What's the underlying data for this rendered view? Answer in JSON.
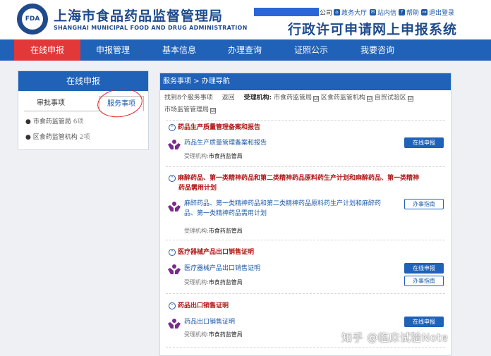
{
  "header": {
    "logo_text": "FDA",
    "org_name_cn": "上海市食品药品监督管理局",
    "org_name_en": "SHANGHAI MUNICIPAL FOOD AND DRUG ADMINISTRATION",
    "company_suffix": "公司",
    "links": [
      "政务大厅",
      "站内信",
      "帮助",
      "退出登录"
    ],
    "system_title": "行政许可申请网上申报系统"
  },
  "nav": {
    "items": [
      "在线申报",
      "申报管理",
      "基本信息",
      "办理查询",
      "证照公示",
      "我要咨询"
    ],
    "active": "在线申报"
  },
  "sidebar": {
    "title": "在线申报",
    "tabs": [
      "审批事项",
      "服务事项"
    ],
    "selected_tab": "服务事项",
    "items": [
      {
        "label": "市食药监管局",
        "count": "6项"
      },
      {
        "label": "区食药监管机构",
        "count": "2项"
      }
    ]
  },
  "main": {
    "breadcrumb": "服务事项 > 办理导航",
    "filter": {
      "found": "找到8个服务事项",
      "back": "返回",
      "label": "受理机构:",
      "options": [
        "市食药监管局",
        "区食药监管机构",
        "自贸试验区",
        "市场监管管理局"
      ],
      "check": "☑"
    },
    "sections": [
      {
        "title": "药品生产质量管理备案和报告",
        "item": "药品生产质量管理备案和报告",
        "agency_label": "受理机构:",
        "agency": "市食药监管局",
        "buttons": [
          "在线申报"
        ]
      },
      {
        "title_line1": "麻醉药品、第一类精神药品和第二类精神药品原料药生产计划和麻醉药品、第一类精神",
        "title_line2": "药品需用计划",
        "item_line1": "麻醉药品、第一类精神药品和第二类精神药品原料药生产计划和麻醉药",
        "item_line2": "品、第一类精神药品需用计划",
        "agency_label": "受理机构:",
        "agency": "市食药监管局",
        "buttons": [
          "办事指南"
        ]
      },
      {
        "title": "医疗器械产品出口销售证明",
        "item": "医疗器械产品出口销售证明",
        "agency_label": "受理机构:",
        "agency": "市食药监管局",
        "buttons": [
          "在线申报",
          "办事指南"
        ]
      },
      {
        "title": "药品出口销售证明",
        "item": "药品出口销售证明",
        "agency_label": "受理机构:",
        "agency": "市食药监管局",
        "buttons": [
          "在线申报"
        ]
      }
    ],
    "collapse_icon": "⌃"
  },
  "watermark": "知乎 @临床试验Note",
  "colors": {
    "brand_blue": "#1f62b8",
    "active_red": "#e2383a",
    "title_red": "#b01717"
  }
}
